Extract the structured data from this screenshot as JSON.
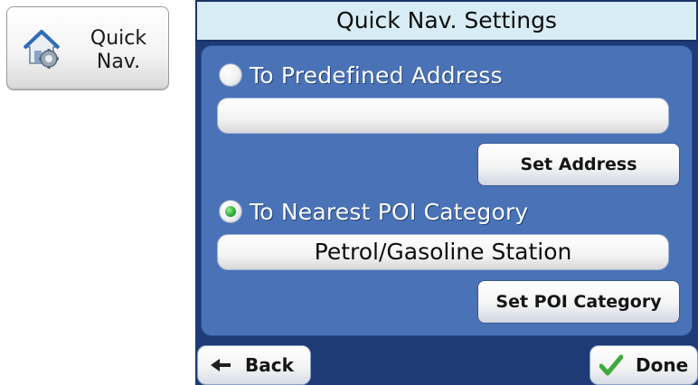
{
  "quick_nav_button": {
    "label": "Quick\nNav.",
    "icon": "house-gear-icon"
  },
  "screen": {
    "title": "Quick Nav. Settings",
    "option_predefined": {
      "label": "To Predefined Address",
      "selected": false
    },
    "address_field": {
      "value": ""
    },
    "set_address_button": "Set Address",
    "option_poi": {
      "label": "To Nearest POI Category",
      "selected": true
    },
    "poi_field": {
      "value": "Petrol/Gasoline Station"
    },
    "set_poi_button": "Set POI Category",
    "back_button": "Back",
    "done_button": "Done"
  },
  "colors": {
    "panel_bg": "#1e3b76",
    "body_bg": "#4a72b6",
    "title_bg": "#d7ecf4",
    "radio_selected": "#2fa83a",
    "done_check": "#3caa3c"
  }
}
